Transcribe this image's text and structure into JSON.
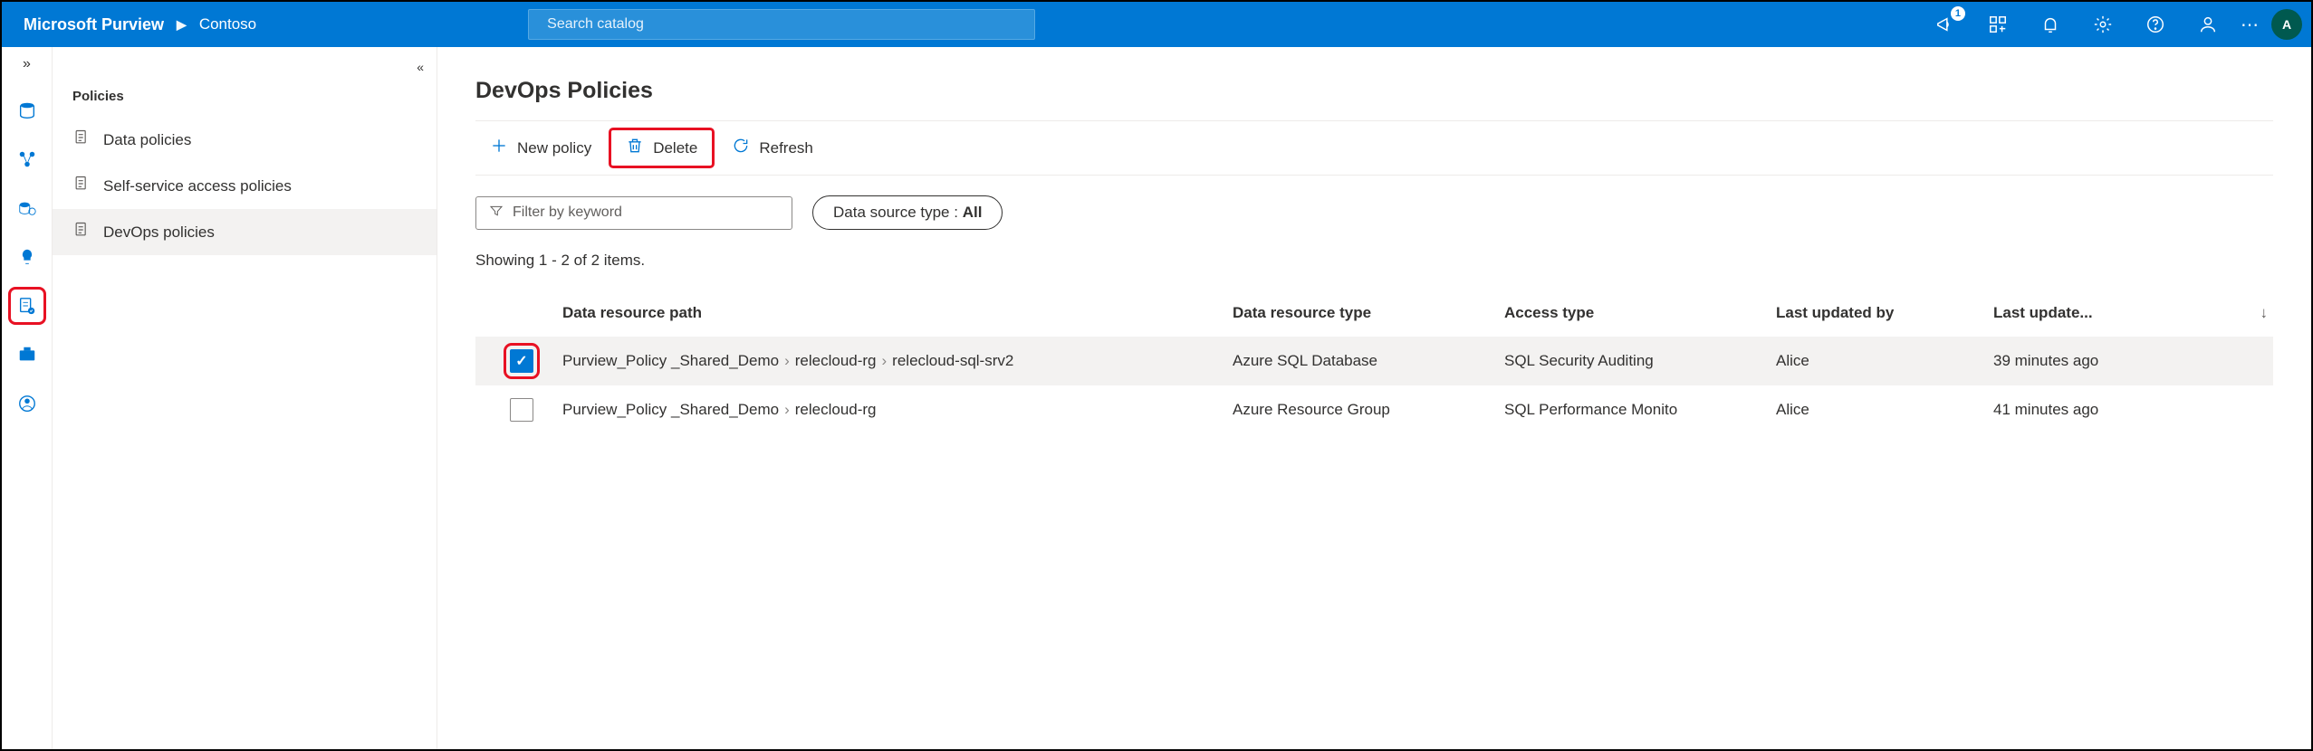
{
  "header": {
    "brand": "Microsoft Purview",
    "crumb": "Contoso",
    "search_placeholder": "Search catalog",
    "notification_count": "1",
    "avatar_initial": "A"
  },
  "rail": {
    "highlighted_index": 5
  },
  "sidepanel": {
    "title": "Policies",
    "items": [
      {
        "label": "Data policies",
        "active": false
      },
      {
        "label": "Self-service access policies",
        "active": false
      },
      {
        "label": "DevOps policies",
        "active": true
      }
    ]
  },
  "main": {
    "title": "DevOps Policies",
    "toolbar": {
      "new_label": "New policy",
      "delete_label": "Delete",
      "refresh_label": "Refresh"
    },
    "filter": {
      "keyword_placeholder": "Filter by keyword",
      "datasource_label": "Data source type : ",
      "datasource_value": "All"
    },
    "count_text": "Showing 1 - 2 of 2 items.",
    "columns": {
      "path": "Data resource path",
      "type": "Data resource type",
      "access": "Access type",
      "updated_by": "Last updated by",
      "updated_at": "Last update..."
    },
    "rows": [
      {
        "checked": true,
        "check_highlight": true,
        "path": [
          "Purview_Policy _Shared_Demo",
          "relecloud-rg",
          "relecloud-sql-srv2"
        ],
        "type": "Azure SQL Database",
        "access": "SQL Security Auditing",
        "updated_by": "Alice",
        "updated_at": "39 minutes ago"
      },
      {
        "checked": false,
        "check_highlight": false,
        "path": [
          "Purview_Policy _Shared_Demo",
          "relecloud-rg"
        ],
        "type": "Azure Resource Group",
        "access": "SQL Performance Monito",
        "updated_by": "Alice",
        "updated_at": "41 minutes ago"
      }
    ]
  }
}
